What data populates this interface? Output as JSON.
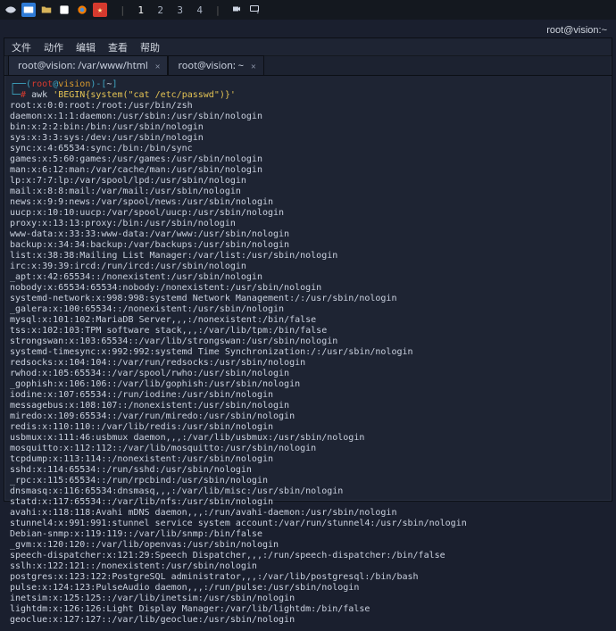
{
  "taskbar": {
    "workspaces": [
      "1",
      "2",
      "3",
      "4"
    ],
    "active_workspace": 0
  },
  "hostline": "root@vision:~",
  "window": {
    "menus": [
      "文件",
      "动作",
      "编辑",
      "查看",
      "帮助"
    ],
    "tabs": [
      {
        "label": "root@vision: /var/www/html",
        "active": false
      },
      {
        "label": "root@vision: ~",
        "active": true
      }
    ]
  },
  "prompt": {
    "user": "root",
    "at": "@",
    "host": "vision",
    "path": "~",
    "symbol": "#"
  },
  "command": {
    "bin": "awk",
    "arg": "'BEGIN{system(\"cat /etc/passwd\")}'"
  },
  "output_lines": [
    "root:x:0:0:root:/root:/usr/bin/zsh",
    "daemon:x:1:1:daemon:/usr/sbin:/usr/sbin/nologin",
    "bin:x:2:2:bin:/bin:/usr/sbin/nologin",
    "sys:x:3:3:sys:/dev:/usr/sbin/nologin",
    "sync:x:4:65534:sync:/bin:/bin/sync",
    "games:x:5:60:games:/usr/games:/usr/sbin/nologin",
    "man:x:6:12:man:/var/cache/man:/usr/sbin/nologin",
    "lp:x:7:7:lp:/var/spool/lpd:/usr/sbin/nologin",
    "mail:x:8:8:mail:/var/mail:/usr/sbin/nologin",
    "news:x:9:9:news:/var/spool/news:/usr/sbin/nologin",
    "uucp:x:10:10:uucp:/var/spool/uucp:/usr/sbin/nologin",
    "proxy:x:13:13:proxy:/bin:/usr/sbin/nologin",
    "www-data:x:33:33:www-data:/var/www:/usr/sbin/nologin",
    "backup:x:34:34:backup:/var/backups:/usr/sbin/nologin",
    "list:x:38:38:Mailing List Manager:/var/list:/usr/sbin/nologin",
    "irc:x:39:39:ircd:/run/ircd:/usr/sbin/nologin",
    "_apt:x:42:65534::/nonexistent:/usr/sbin/nologin",
    "nobody:x:65534:65534:nobody:/nonexistent:/usr/sbin/nologin",
    "systemd-network:x:998:998:systemd Network Management:/:/usr/sbin/nologin",
    "_galera:x:100:65534::/nonexistent:/usr/sbin/nologin",
    "mysql:x:101:102:MariaDB Server,,,:/nonexistent:/bin/false",
    "tss:x:102:103:TPM software stack,,,:/var/lib/tpm:/bin/false",
    "strongswan:x:103:65534::/var/lib/strongswan:/usr/sbin/nologin",
    "systemd-timesync:x:992:992:systemd Time Synchronization:/:/usr/sbin/nologin",
    "redsocks:x:104:104::/var/run/redsocks:/usr/sbin/nologin",
    "rwhod:x:105:65534::/var/spool/rwho:/usr/sbin/nologin",
    "_gophish:x:106:106::/var/lib/gophish:/usr/sbin/nologin",
    "iodine:x:107:65534::/run/iodine:/usr/sbin/nologin",
    "messagebus:x:108:107::/nonexistent:/usr/sbin/nologin",
    "miredo:x:109:65534::/var/run/miredo:/usr/sbin/nologin",
    "redis:x:110:110::/var/lib/redis:/usr/sbin/nologin",
    "usbmux:x:111:46:usbmux daemon,,,:/var/lib/usbmux:/usr/sbin/nologin",
    "mosquitto:x:112:112::/var/lib/mosquitto:/usr/sbin/nologin",
    "tcpdump:x:113:114::/nonexistent:/usr/sbin/nologin",
    "sshd:x:114:65534::/run/sshd:/usr/sbin/nologin",
    "_rpc:x:115:65534::/run/rpcbind:/usr/sbin/nologin",
    "dnsmasq:x:116:65534:dnsmasq,,,:/var/lib/misc:/usr/sbin/nologin",
    "statd:x:117:65534::/var/lib/nfs:/usr/sbin/nologin",
    "avahi:x:118:118:Avahi mDNS daemon,,,:/run/avahi-daemon:/usr/sbin/nologin",
    "stunnel4:x:991:991:stunnel service system account:/var/run/stunnel4:/usr/sbin/nologin",
    "Debian-snmp:x:119:119::/var/lib/snmp:/bin/false",
    "_gvm:x:120:120::/var/lib/openvas:/usr/sbin/nologin",
    "speech-dispatcher:x:121:29:Speech Dispatcher,,,:/run/speech-dispatcher:/bin/false",
    "sslh:x:122:121::/nonexistent:/usr/sbin/nologin",
    "postgres:x:123:122:PostgreSQL administrator,,,:/var/lib/postgresql:/bin/bash",
    "pulse:x:124:123:PulseAudio daemon,,,:/run/pulse:/usr/sbin/nologin",
    "inetsim:x:125:125::/var/lib/inetsim:/usr/sbin/nologin",
    "lightdm:x:126:126:Light Display Manager:/var/lib/lightdm:/bin/false",
    "geoclue:x:127:127::/var/lib/geoclue:/usr/sbin/nologin"
  ]
}
